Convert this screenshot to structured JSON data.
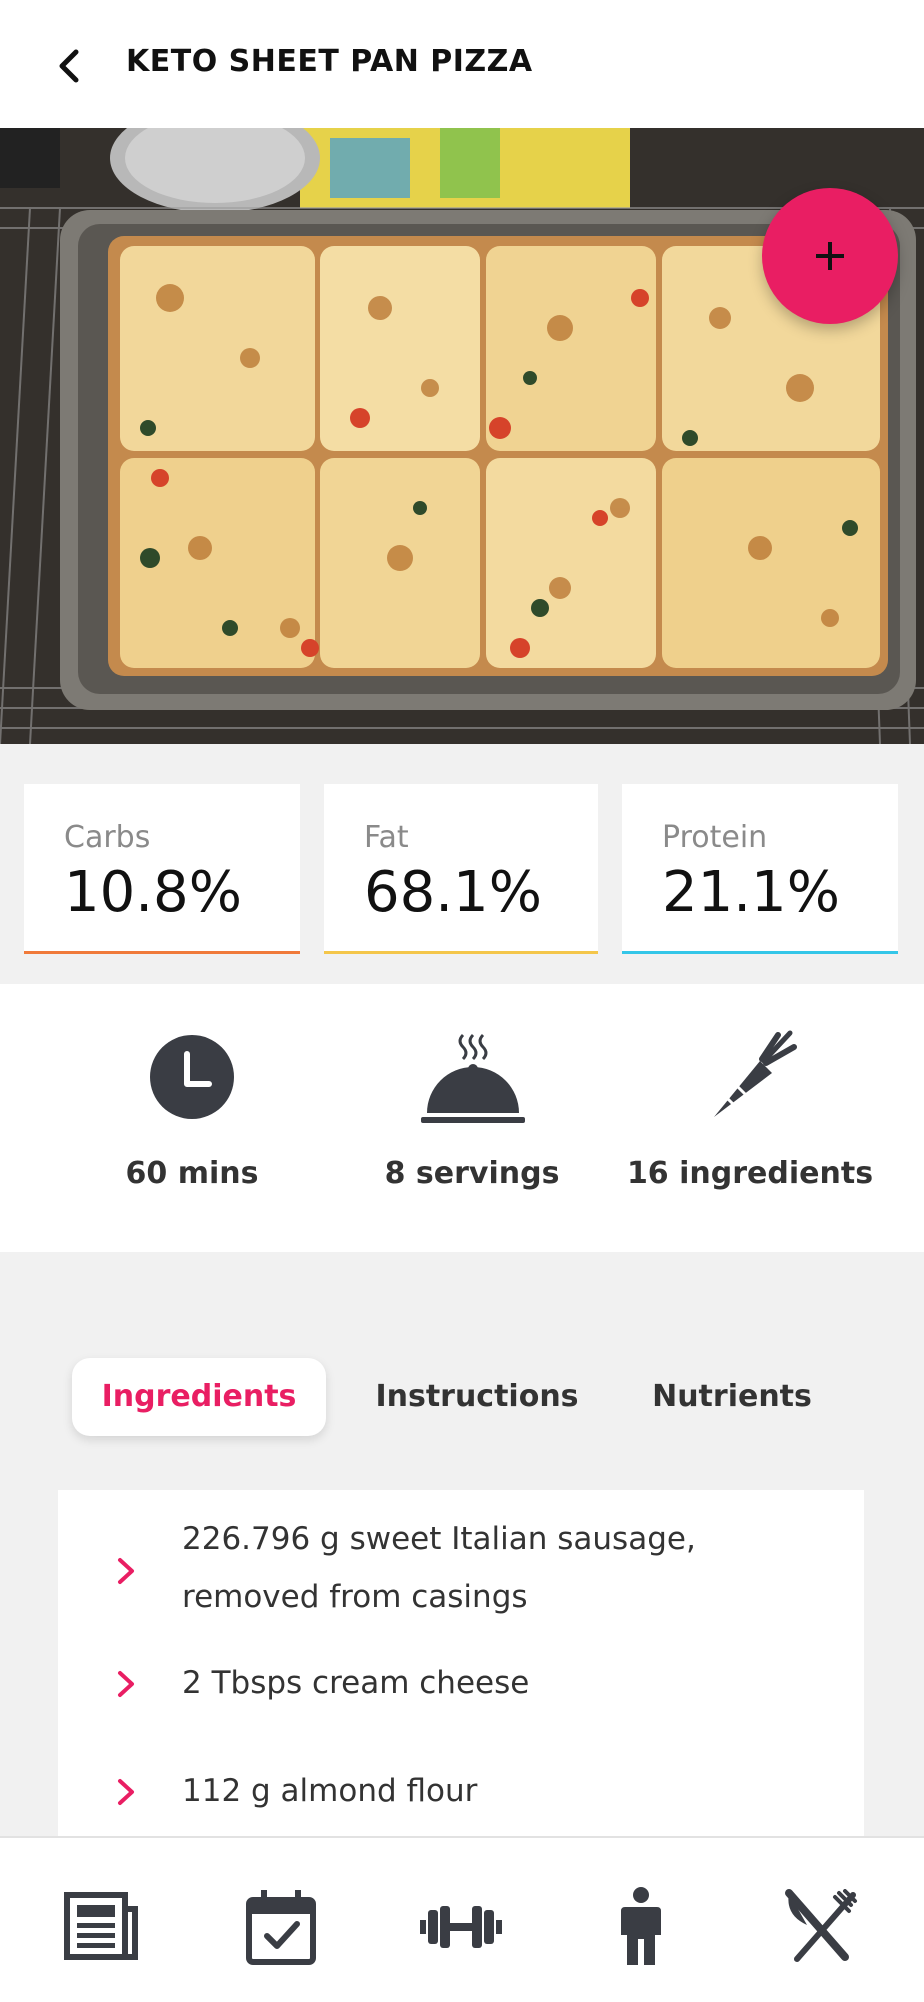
{
  "header": {
    "title": "KETO SHEET PAN PIZZA"
  },
  "macros": [
    {
      "label": "Carbs",
      "value": "10.8%",
      "color": "#f07a3a"
    },
    {
      "label": "Fat",
      "value": "68.1%",
      "color": "#f4c64a"
    },
    {
      "label": "Protein",
      "value": "21.1%",
      "color": "#34c6e8"
    }
  ],
  "stats": {
    "time": "60 mins",
    "servings": "8 servings",
    "ingredients": "16 ingredients"
  },
  "tabs": [
    {
      "label": "Ingredients",
      "active": true
    },
    {
      "label": "Instructions",
      "active": false
    },
    {
      "label": "Nutrients",
      "active": false
    }
  ],
  "ingredients": [
    {
      "line1": "226.796 g sweet Italian sausage,",
      "line2": "removed from casings"
    },
    {
      "line1": "2 Tbsps cream cheese"
    },
    {
      "line1": "112 g almond flour"
    }
  ],
  "colors": {
    "accent": "#e91e63",
    "icon": "#3a3d44"
  },
  "nav_icons": [
    "news-icon",
    "calendar-icon",
    "dumbbell-icon",
    "person-icon",
    "fork-knife-icon"
  ]
}
